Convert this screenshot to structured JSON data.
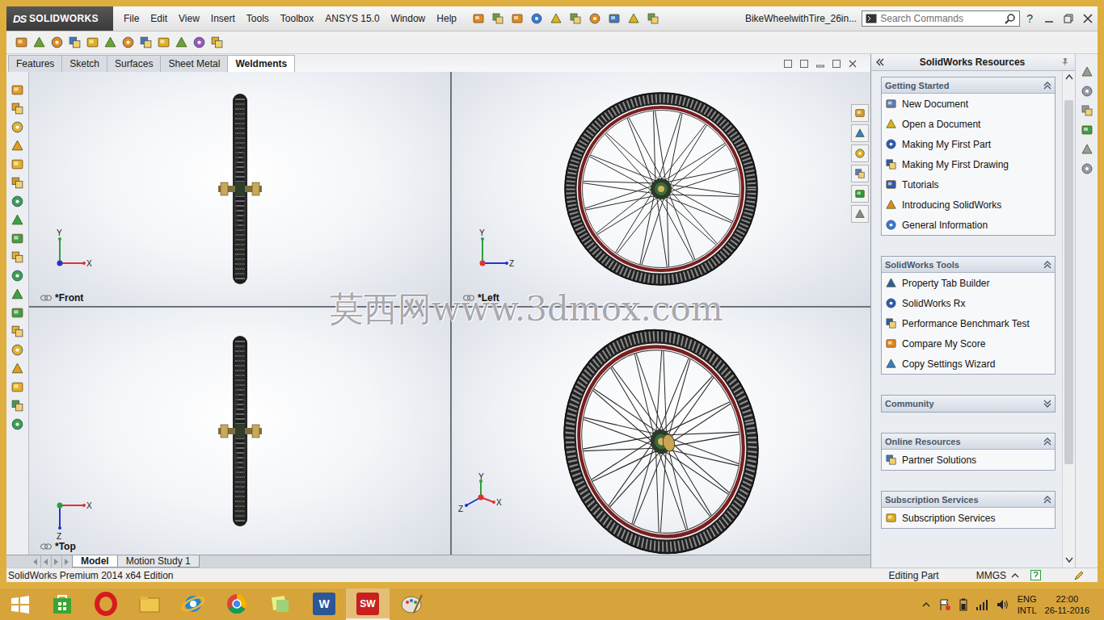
{
  "logo": {
    "mark": "DS",
    "name": "SOLIDWORKS"
  },
  "menu": [
    "File",
    "Edit",
    "View",
    "Insert",
    "Tools",
    "Toolbox",
    "ANSYS 15.0",
    "Window",
    "Help"
  ],
  "document": {
    "title": "BikeWheelwithTire_26in..."
  },
  "search": {
    "placeholder": "Search Commands"
  },
  "help": "?",
  "tabs": [
    {
      "label": "Features",
      "selected": false
    },
    {
      "label": "Sketch",
      "selected": false
    },
    {
      "label": "Surfaces",
      "selected": false
    },
    {
      "label": "Sheet Metal",
      "selected": false
    },
    {
      "label": "Weldments",
      "selected": true
    }
  ],
  "viewports": [
    {
      "kind": "front",
      "label": "*Front",
      "axes": [
        "Y",
        "X"
      ]
    },
    {
      "kind": "left",
      "label": "*Left",
      "axes": [
        "Y",
        "Z"
      ]
    },
    {
      "kind": "top",
      "label": "*Top",
      "axes": [
        "X",
        "Z"
      ]
    },
    {
      "kind": "iso",
      "axes": [
        "Y",
        "X",
        "Z"
      ]
    }
  ],
  "watermark": "莫西网www.3dmox.com",
  "task_pane": {
    "title": "SolidWorks Resources",
    "sections": [
      {
        "title": "Getting Started",
        "expanded": true,
        "items": [
          "New Document",
          "Open a Document",
          "Making My First Part",
          "Making My First Drawing",
          "Tutorials",
          "Introducing SolidWorks",
          "General Information"
        ]
      },
      {
        "title": "SolidWorks Tools",
        "expanded": true,
        "items": [
          "Property Tab Builder",
          "SolidWorks Rx",
          "Performance Benchmark Test",
          "Compare My Score",
          "Copy Settings Wizard"
        ]
      },
      {
        "title": "Community",
        "expanded": false,
        "items": []
      },
      {
        "title": "Online Resources",
        "expanded": true,
        "items": [
          "Partner Solutions"
        ]
      },
      {
        "title": "Subscription Services",
        "expanded": true,
        "items": [
          "Subscription Services"
        ]
      }
    ]
  },
  "bottom_tabs": [
    {
      "label": "Model",
      "selected": true
    },
    {
      "label": "Motion Study 1",
      "selected": false
    }
  ],
  "status_bar": {
    "edition": "SolidWorks Premium 2014 x64 Edition",
    "mode": "Editing Part",
    "units": "MMGS"
  },
  "taskbar": {
    "apps": [
      {
        "kind": "store",
        "selected": false
      },
      {
        "kind": "opera",
        "selected": false
      },
      {
        "kind": "explorer",
        "selected": false
      },
      {
        "kind": "ie",
        "selected": false
      },
      {
        "kind": "chrome",
        "selected": false
      },
      {
        "kind": "notes",
        "selected": false
      },
      {
        "kind": "word",
        "badge": "W",
        "selected": false
      },
      {
        "kind": "solidworks",
        "badge": "SW",
        "selected": true
      },
      {
        "kind": "paint",
        "selected": false
      }
    ],
    "language": "ENG",
    "layout": "INTL",
    "time": "22:00",
    "date": "26-11-2016"
  }
}
